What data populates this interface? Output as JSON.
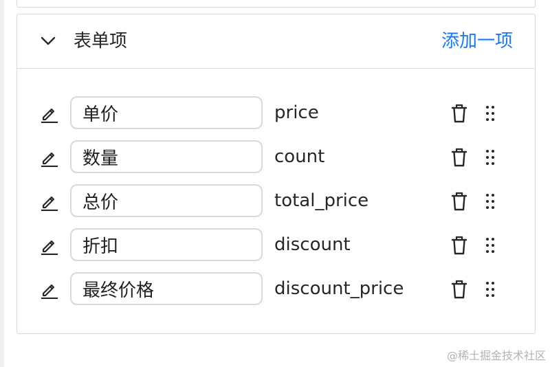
{
  "panel": {
    "title": "表单项",
    "add_label": "添加一项"
  },
  "rows": [
    {
      "label": "单价",
      "key": "price"
    },
    {
      "label": "数量",
      "key": "count"
    },
    {
      "label": "总价",
      "key": "total_price"
    },
    {
      "label": "折扣",
      "key": "discount"
    },
    {
      "label": "最终价格",
      "key": "discount_price"
    }
  ],
  "icons": {
    "collapse": "chevron-down-icon",
    "edit": "pencil-icon",
    "delete": "trash-icon",
    "drag": "drag-handle-icon"
  },
  "colors": {
    "accent": "#1677ff",
    "border": "#d9d9d9"
  },
  "watermark": "@稀土掘金技术社区"
}
